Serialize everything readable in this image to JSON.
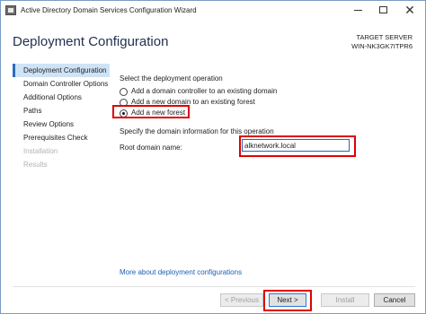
{
  "window": {
    "title": "Active Directory Domain Services Configuration Wizard",
    "minimize_glyph": "—",
    "close_glyph": "✕"
  },
  "header": {
    "page_title": "Deployment Configuration",
    "target_label": "TARGET SERVER",
    "target_name": "WIN-NK3GK7ITPR6"
  },
  "nav": {
    "items": [
      {
        "label": "Deployment Configuration",
        "state": "active"
      },
      {
        "label": "Domain Controller Options",
        "state": "normal"
      },
      {
        "label": "Additional Options",
        "state": "normal"
      },
      {
        "label": "Paths",
        "state": "normal"
      },
      {
        "label": "Review Options",
        "state": "normal"
      },
      {
        "label": "Prerequisites Check",
        "state": "normal"
      },
      {
        "label": "Installation",
        "state": "disabled"
      },
      {
        "label": "Results",
        "state": "disabled"
      }
    ]
  },
  "content": {
    "operation_heading": "Select the deployment operation",
    "options": [
      {
        "label": "Add a domain controller to an existing domain",
        "checked": false
      },
      {
        "label": "Add a new domain to an existing forest",
        "checked": false
      },
      {
        "label": "Add a new forest",
        "checked": true
      }
    ],
    "domain_heading": "Specify the domain information for this operation",
    "root_domain_label": "Root domain name:",
    "root_domain_value": "alknetwork.local",
    "more_link": "More about deployment configurations"
  },
  "buttons": {
    "previous": "< Previous",
    "next": "Next >",
    "install": "Install",
    "cancel": "Cancel"
  },
  "colors": {
    "highlight": "#e10000",
    "accent": "#2e6bbd",
    "link": "#1a5fb4"
  }
}
